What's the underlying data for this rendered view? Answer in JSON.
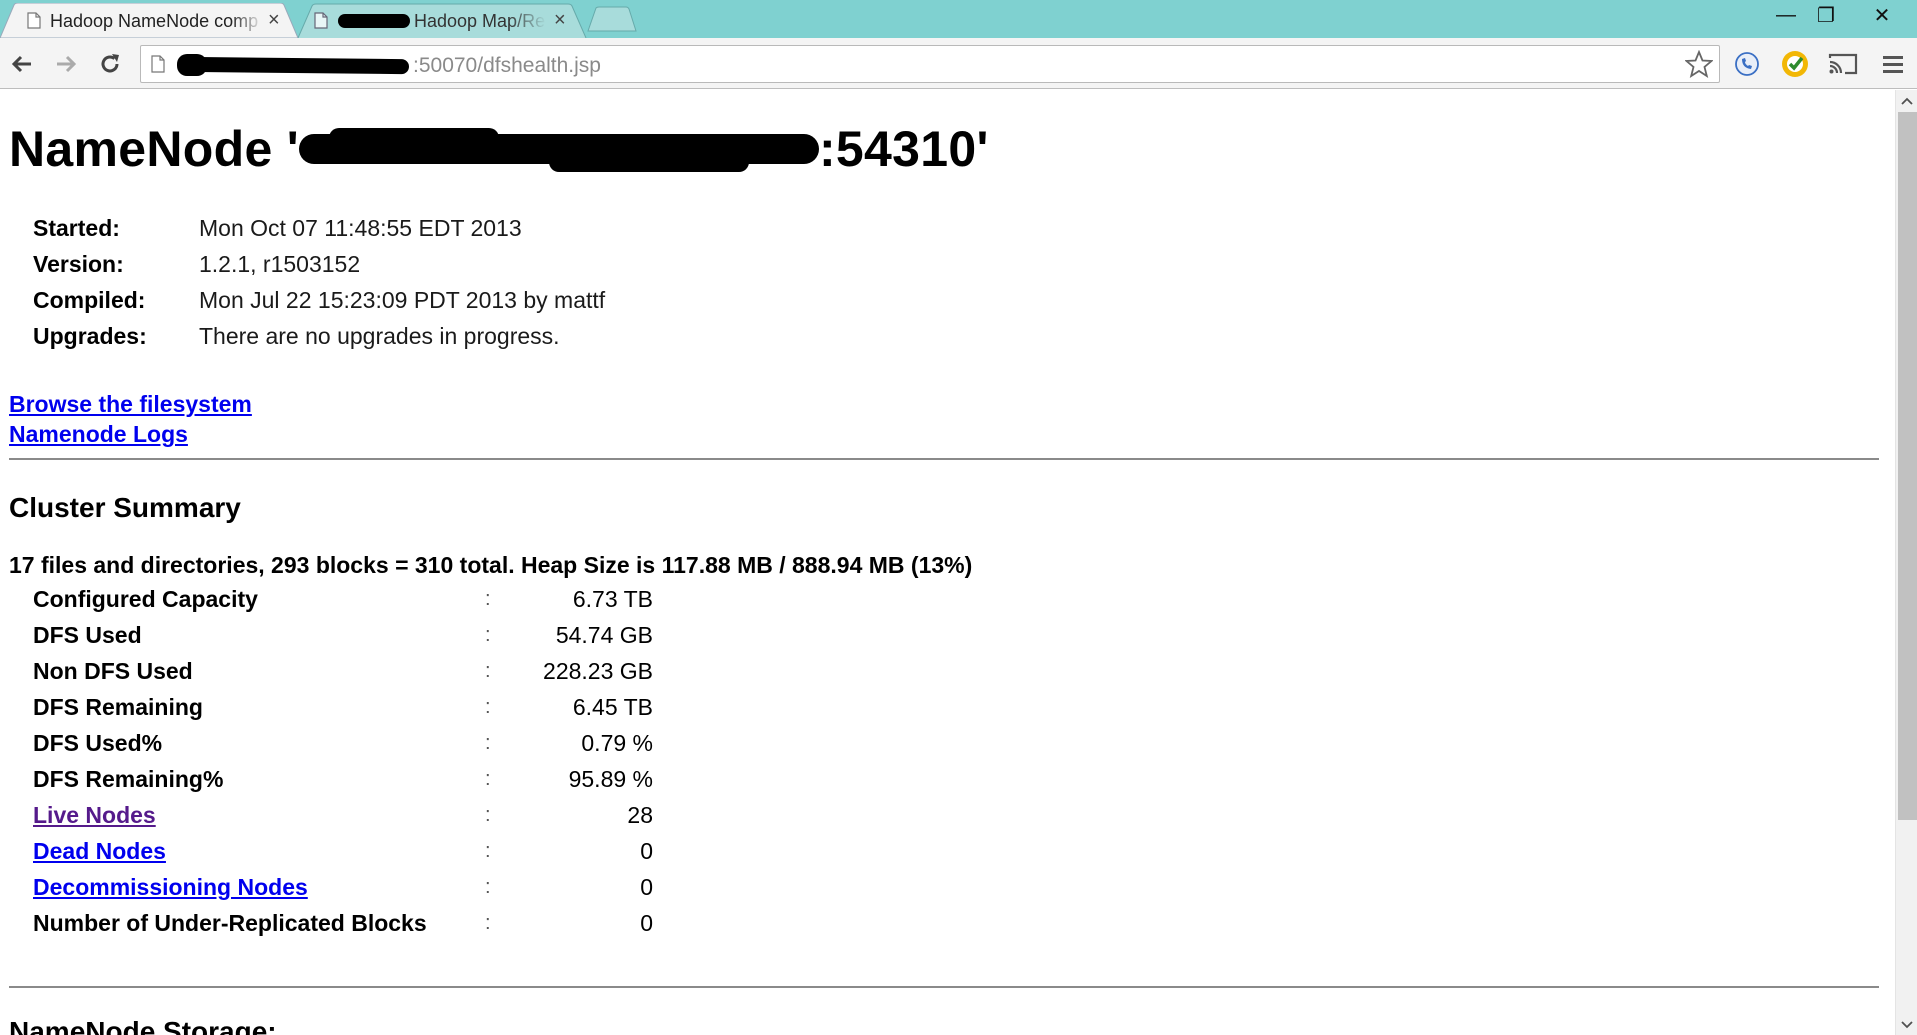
{
  "browser": {
    "tabs": [
      {
        "title": "Hadoop NameNode comp",
        "active": true,
        "close": "×"
      },
      {
        "title": "Hadoop Map/Re",
        "active": false,
        "close": "×"
      }
    ],
    "window_buttons": {
      "minimize": "—",
      "restore": "❐",
      "close": "✕"
    },
    "url": {
      "host_visible": ":50070",
      "path": "/dfshealth.jsp"
    },
    "icons": [
      "back-arrow-icon",
      "forward-arrow-icon",
      "reload-icon",
      "page-icon",
      "bookmark-star-icon",
      "phone-extension-icon",
      "norton-extension-icon",
      "cast-icon",
      "menu-icon"
    ]
  },
  "page": {
    "title_prefix": "NameNode '",
    "title_suffix": ":54310'",
    "info": [
      {
        "label": "Started:",
        "value": "Mon Oct 07 11:48:55 EDT 2013"
      },
      {
        "label": "Version:",
        "value": "1.2.1, r1503152"
      },
      {
        "label": "Compiled:",
        "value": "Mon Jul 22 15:23:09 PDT 2013 by mattf"
      },
      {
        "label": "Upgrades:",
        "value": "There are no upgrades in progress."
      }
    ],
    "links": {
      "browse": "Browse the filesystem",
      "logs": "Namenode Logs"
    },
    "cluster_summary": {
      "heading": "Cluster Summary",
      "summary_line": "17 files and directories, 293 blocks = 310 total. Heap Size is 117.88 MB / 888.94 MB (13%)",
      "separator": ":",
      "rows": [
        {
          "label": "Configured Capacity",
          "value": "6.73 TB",
          "link": false
        },
        {
          "label": "DFS Used",
          "value": "54.74 GB",
          "link": false
        },
        {
          "label": "Non DFS Used",
          "value": "228.23 GB",
          "link": false
        },
        {
          "label": "DFS Remaining",
          "value": "6.45 TB",
          "link": false
        },
        {
          "label": "DFS Used%",
          "value": "0.79 %",
          "link": false
        },
        {
          "label": "DFS Remaining%",
          "value": "95.89 %",
          "link": false
        },
        {
          "label": "Live Nodes",
          "value": "28",
          "link": true,
          "visited": true
        },
        {
          "label": "Dead Nodes",
          "value": "0",
          "link": true
        },
        {
          "label": "Decommissioning Nodes",
          "value": "0",
          "link": true
        },
        {
          "label": "Number of Under-Replicated Blocks",
          "value": "0",
          "link": false
        }
      ]
    },
    "storage_heading": "NameNode Storage:"
  },
  "colors": {
    "titlebar": "#7fd1d0",
    "link": "#0000ee",
    "visited_link": "#551a8b"
  }
}
